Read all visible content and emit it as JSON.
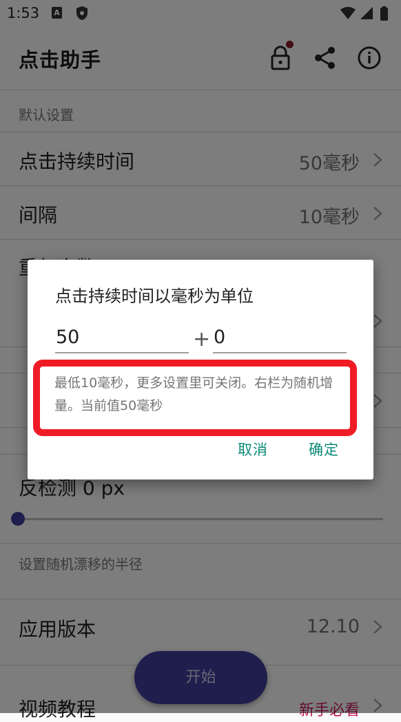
{
  "status_bar": {
    "time": "1:53",
    "icons": [
      "app-a-icon",
      "shield-icon",
      "wifi-icon",
      "signal-icon",
      "battery-icon"
    ]
  },
  "app_bar": {
    "title": "点击助手",
    "actions": [
      "lock-icon",
      "share-icon",
      "info-icon"
    ],
    "lock_badge_color": "#8b1a2c"
  },
  "settings": {
    "section_default": "默认设置",
    "click_duration": {
      "label": "点击持续时间",
      "value": "50毫秒"
    },
    "interval": {
      "label": "间隔",
      "value": "10毫秒"
    },
    "repeat_partial": "重复次数",
    "anti_detect": {
      "label": "反检测 0 px",
      "slider_value": 0
    },
    "drift_desc": "设置随机漂移的半径",
    "app_version": {
      "label": "应用版本",
      "value": "12.10"
    },
    "video_tutorial": {
      "label": "视频教程",
      "value": "新手必看"
    }
  },
  "fab": {
    "label": "开始"
  },
  "dialog": {
    "title": "点击持续时间以毫秒为单位",
    "input_value": "50",
    "plus": "+",
    "random_value": "0",
    "hint": "最低10毫秒，更多设置里可关闭。右栏为随机增量。当前值50毫秒",
    "cancel": "取消",
    "ok": "确定",
    "accent_color": "#0a8a78",
    "highlight_color": "#ef1c25"
  }
}
